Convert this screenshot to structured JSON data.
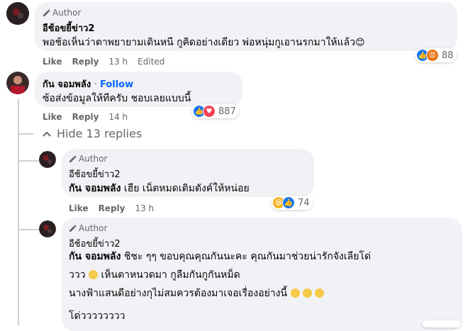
{
  "comments": [
    {
      "author_badge": "Author",
      "name": "อีช้อขยี้ข่าว2",
      "text": "พอช้อเห็นว่าตาพยายามเดินหนี กูคิดอย่างเดียว พ่อหนุ่มกูเอานรกมาให้แล้ว",
      "emoji": "😊",
      "like": "Like",
      "reply": "Reply",
      "time": "13 h",
      "edited": "Edited",
      "reaction_count": "88"
    },
    {
      "name": "กัน จอมพลัง",
      "follow": "Follow",
      "text": "ซ้อส่งข้อมูลให้ทีครับ ชอบเลยแบบนี้",
      "like": "Like",
      "reply": "Reply",
      "time": "14 h",
      "reaction_count": "887"
    }
  ],
  "hide_replies": "Hide 13 replies",
  "replies": [
    {
      "author_badge": "Author",
      "name": "อีช้อขยี้ข่าว2",
      "mention": "กัน จอมพลัง",
      "text": "เฮีย เน็ตหมดเติมตังค์ให้หน่อย",
      "like": "Like",
      "reply": "Reply",
      "time": "13 h",
      "reaction_count": "74"
    },
    {
      "author_badge": "Author",
      "name": "อีช้อขยี้ข่าว2",
      "mention": "กัน จอมพลัง",
      "line1": "ชิชะ ๆๆ ขอบคุณคุณกันนะคะ คุณกันมาช่วยน่ารักจังเลียโด่",
      "line2a": "ววว",
      "line2b": "เห็นตาหนวดมา กูลืมกันกูกันหม็ด",
      "line3": "นางฟ้าแสนดีอย่างกุไม่สมควรต้องมาเจอเรื่องอย่างนี้",
      "line4": "โด่วววววววว"
    }
  ]
}
